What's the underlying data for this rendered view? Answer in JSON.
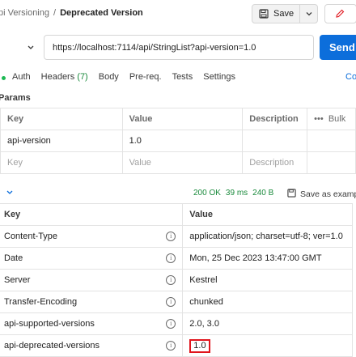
{
  "breadcrumb": {
    "parent": "pi Versioning",
    "separator": "/",
    "current": "Deprecated Version"
  },
  "toolbar": {
    "save_label": "Save",
    "save_icon": "floppy-disk-icon",
    "edit_icon": "pencil-icon"
  },
  "request": {
    "url": "https://localhost:7114/api/StringList?api-version=1.0",
    "send_label": "Send"
  },
  "tabs": {
    "auth": "Auth",
    "headers": "Headers",
    "headers_count": "(7)",
    "body": "Body",
    "prereq": "Pre-req.",
    "tests": "Tests",
    "settings": "Settings",
    "cookies": "Co"
  },
  "params": {
    "title": "Params",
    "columns": {
      "key": "Key",
      "value": "Value",
      "description": "Description",
      "more": "•••",
      "bulk": "Bulk"
    },
    "rows": [
      {
        "key": "api-version",
        "value": "1.0",
        "description": ""
      }
    ],
    "placeholder": {
      "key": "Key",
      "value": "Value",
      "description": "Description"
    }
  },
  "response": {
    "status": "200 OK",
    "time": "39 ms",
    "size": "240 B",
    "save_as": "Save as examp",
    "columns": {
      "key": "Key",
      "value": "Value"
    },
    "headers": [
      {
        "key": "Content-Type",
        "value": "application/json; charset=utf-8; ver=1.0"
      },
      {
        "key": "Date",
        "value": "Mon, 25 Dec 2023 13:47:00 GMT"
      },
      {
        "key": "Server",
        "value": "Kestrel"
      },
      {
        "key": "Transfer-Encoding",
        "value": "chunked"
      },
      {
        "key": "api-supported-versions",
        "value": "2.0, 3.0"
      },
      {
        "key": "api-deprecated-versions",
        "value": "1.0"
      }
    ]
  },
  "colors": {
    "accent": "#0c6edb",
    "success": "#1a8a3c",
    "highlight": "#e0151d"
  }
}
